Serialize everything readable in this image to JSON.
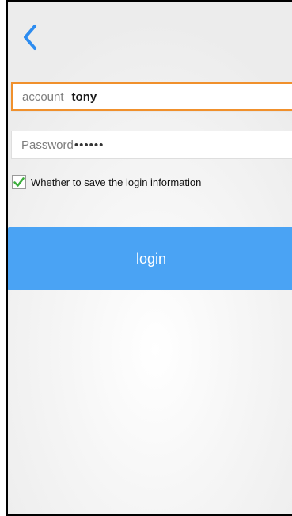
{
  "nav": {
    "back_icon": "chevron-left-icon",
    "accent_color": "#2d8cf0"
  },
  "form": {
    "account_label": "account",
    "account_value": "tony",
    "account_focus_color": "#f0902c",
    "password_label": "Password",
    "password_value": "••••••",
    "remember_label": "Whether to save the login information",
    "remember_checked": true,
    "check_color": "#3cae3c"
  },
  "login_button": {
    "label": "login",
    "color": "#4aa3f4"
  }
}
